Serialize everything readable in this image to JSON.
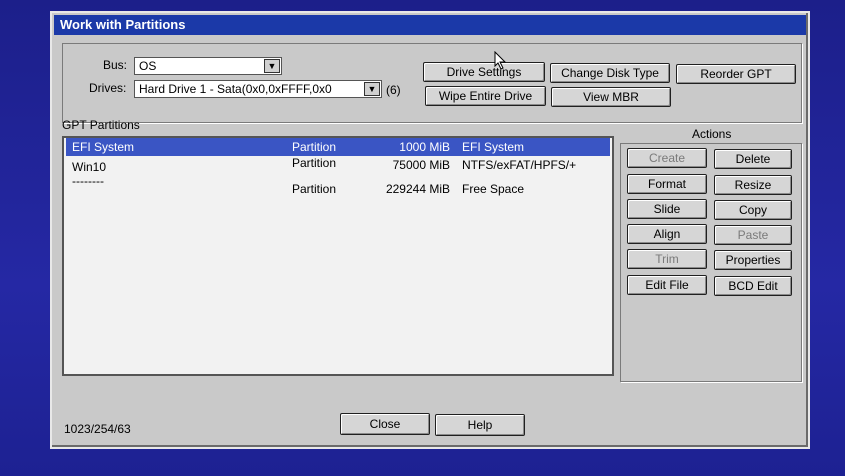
{
  "window": {
    "title": "Work with Partitions"
  },
  "bus": {
    "label": "Bus:",
    "value": "OS"
  },
  "drives": {
    "label": "Drives:",
    "value": "Hard Drive 1 - Sata(0x0,0xFFFF,0x0",
    "count": "(6)"
  },
  "toolbar": {
    "drive_settings": "Drive Settings",
    "change_disk_type": "Change Disk Type",
    "reorder_gpt": "Reorder GPT",
    "wipe_entire_drive": "Wipe Entire Drive",
    "view_mbr": "View MBR"
  },
  "partitions": {
    "title": "GPT Partitions",
    "rows": [
      {
        "name": "EFI System",
        "type": "Partition",
        "size": "1000 MiB",
        "fs": "EFI System",
        "selected": true
      },
      {
        "name": "Win10",
        "type": "Partition",
        "size": "75000 MiB",
        "fs": "NTFS/exFAT/HPFS/+",
        "selected": false
      },
      {
        "name": "--------",
        "type": "Partition",
        "size": "229244 MiB",
        "fs": "Free Space",
        "selected": false
      }
    ]
  },
  "actions": {
    "title": "Actions",
    "create": "Create",
    "delete": "Delete",
    "format": "Format",
    "resize": "Resize",
    "slide": "Slide",
    "copy": "Copy",
    "align": "Align",
    "paste": "Paste",
    "trim": "Trim",
    "properties": "Properties",
    "edit_file": "Edit File",
    "bcd_edit": "BCD Edit"
  },
  "footer": {
    "geometry": "1023/254/63",
    "close": "Close",
    "help": "Help"
  },
  "colors": {
    "titlebar": "#1b39a8",
    "selection": "#3a55c4",
    "window_bg": "#c9c9c9",
    "desktop": "#1c1f8a"
  }
}
